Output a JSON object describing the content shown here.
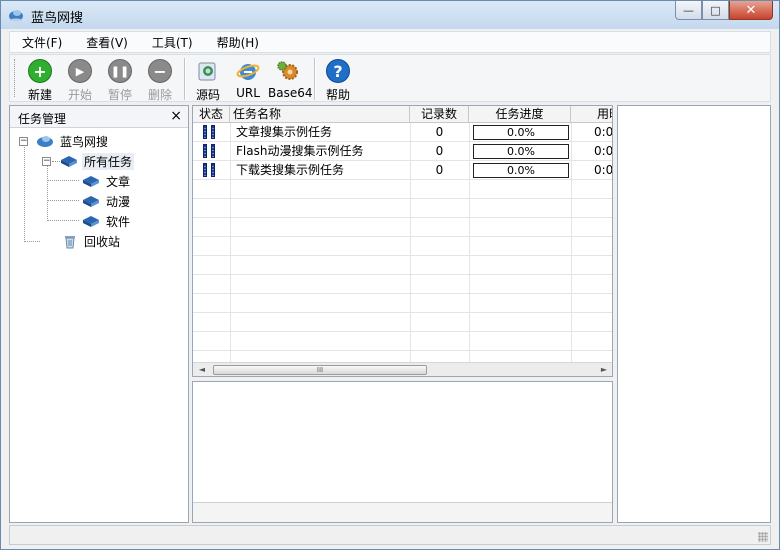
{
  "window": {
    "title": "蓝鸟网搜",
    "controls": {
      "minimize": "—",
      "maximize": "□",
      "close": "✕"
    }
  },
  "menu": [
    "文件(F)",
    "查看(V)",
    "工具(T)",
    "帮助(H)"
  ],
  "toolbar": {
    "new": {
      "label": "新建",
      "icon": "plus-circle-icon",
      "color": "#2fae2f"
    },
    "start": {
      "label": "开始",
      "icon": "play-circle-icon",
      "color": "#8a8a8a"
    },
    "pause": {
      "label": "暂停",
      "icon": "pause-circle-icon",
      "color": "#8a8a8a"
    },
    "delete": {
      "label": "删除",
      "icon": "minus-circle-icon",
      "color": "#8a8a8a"
    },
    "source": {
      "label": "源码",
      "icon": "source-code-icon"
    },
    "url": {
      "label": "URL",
      "icon": "ie-globe-icon"
    },
    "base64": {
      "label": "Base64",
      "icon": "gears-icon"
    },
    "help": {
      "label": "帮助",
      "icon": "help-circle-icon",
      "color": "#1f6fc8"
    }
  },
  "left_pane": {
    "title": "任务管理",
    "close": "×",
    "tree": {
      "root": "蓝鸟网搜",
      "all_tasks": "所有任务",
      "children": [
        "文章",
        "动漫",
        "软件"
      ],
      "recycle": "回收站"
    }
  },
  "grid": {
    "columns": [
      "状态",
      "任务名称",
      "记录数",
      "任务进度",
      "用时"
    ],
    "rows": [
      {
        "name": "文章搜集示例任务",
        "records": "0",
        "progress": "0.0%",
        "time": "0:0"
      },
      {
        "name": "Flash动漫搜集示例任务",
        "records": "0",
        "progress": "0.0%",
        "time": "0:0"
      },
      {
        "name": "下载类搜集示例任务",
        "records": "0",
        "progress": "0.0%",
        "time": "0:0"
      }
    ],
    "scroll": {
      "left": "◄",
      "right": "►",
      "grip": "III"
    }
  },
  "colors": {
    "accent": "#1f6fc8",
    "new_green": "#2fae2f"
  }
}
